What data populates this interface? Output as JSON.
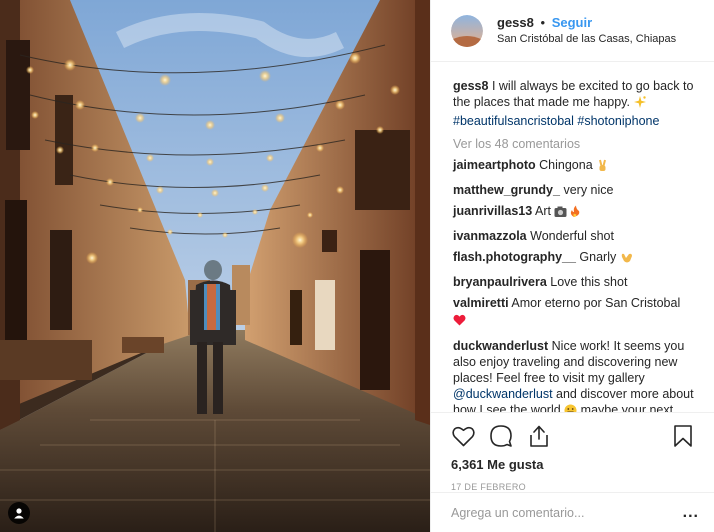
{
  "post": {
    "author": "gess8",
    "follow_label": "Seguir",
    "separator": "•",
    "location": "San Cristóbal de las Casas, Chiapas",
    "caption_user": "gess8",
    "caption_text": "I will always be excited to go back to the places that made me happy.",
    "caption_emoji": "sparkle-icon",
    "hashtags": [
      "#beautifulsancristobal",
      "#shotoniphone"
    ],
    "view_all": "Ver los 48 comentarios",
    "likes": "6,361 Me gusta",
    "date": "17 DE FEBRERO"
  },
  "comments": [
    {
      "user": "jaimeartphoto",
      "text": "Chingona",
      "emoji": "victory-hand-icon"
    },
    {
      "user": "matthew_grundy_",
      "text": "very nice",
      "emoji": ""
    },
    {
      "user": "juanrivillas13",
      "text": "Art",
      "emoji": "camera-fire-icon"
    },
    {
      "user": "ivanmazzola",
      "text": "Wonderful shot",
      "emoji": ""
    },
    {
      "user": "flash.photography__",
      "text": "Gnarly",
      "emoji": "shaka-icon"
    },
    {
      "user": "bryanpaulrivera",
      "text": "Love this shot",
      "emoji": ""
    },
    {
      "user": "valmiretti",
      "text": "Amor eterno por San Cristobal",
      "emoji": "heart-icon"
    }
  ],
  "long_comment": {
    "user": "duckwanderlust",
    "text1": "Nice work! It seems you also enjoy traveling and discovering new places! Feel free to visit my gallery",
    "mention": "@duckwanderlust",
    "text2": "and discover more about how I see the world",
    "emoji": "grin-icon",
    "text3": "maybe your next destination is hidden in one of my photos!"
  },
  "add_comment": {
    "placeholder": "Agrega un comentario...",
    "more": "..."
  },
  "colors": {
    "link_blue": "#3897f0",
    "hashtag": "#003569",
    "muted": "#999999"
  }
}
